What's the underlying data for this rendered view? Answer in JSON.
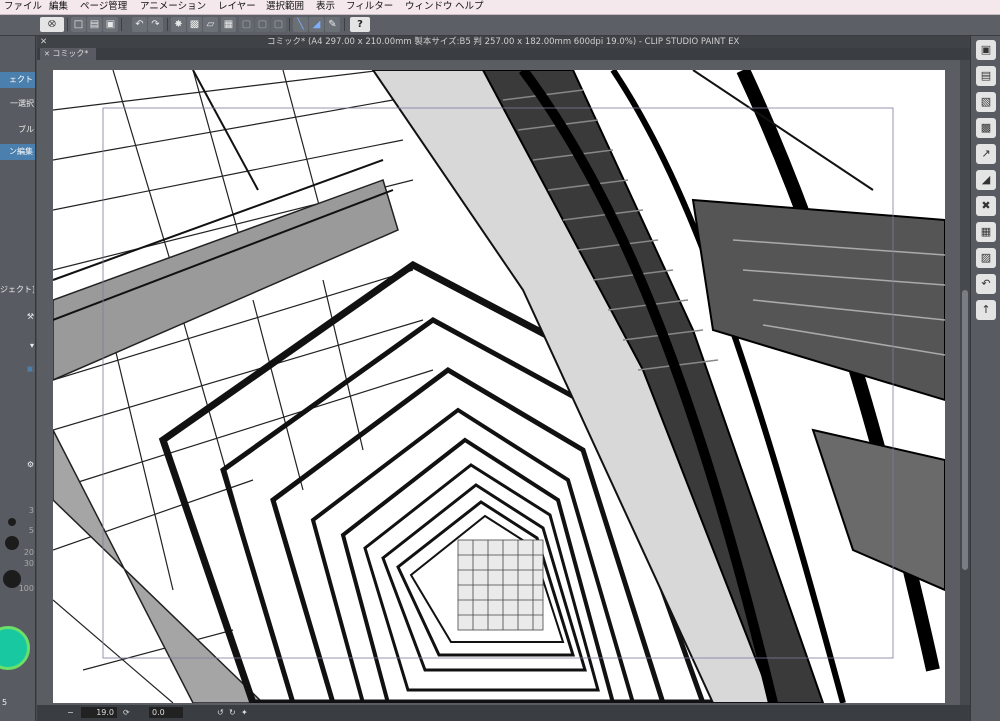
{
  "menu": [
    "ファイル",
    "編集",
    "ページ管理",
    "アニメーション",
    "レイヤー",
    "選択範囲",
    "表示",
    "フィルター",
    "ウィンドウ",
    "ヘルプ"
  ],
  "window_title": "コミック* (A4 297.00 x 210.00mm 製本サイズ:B5 判 257.00 x 182.00mm 600dpi 19.0%)  - CLIP STUDIO PAINT EX",
  "tab_label": "コミック*",
  "left_panel": {
    "items": [
      "ェクト",
      "一選択",
      "ブル",
      "ン編集",
      "ジェクト]"
    ],
    "brush_sizes": [
      "3",
      "5",
      "20",
      "30",
      "100"
    ],
    "bottom_label": "5"
  },
  "status": {
    "zoom": "19.0",
    "rotation": "0.0"
  },
  "toolbar_icons": [
    "clip-logo-icon",
    "new-file-icon",
    "open-file-icon",
    "save-icon",
    "undo-icon",
    "redo-icon",
    "transform-icon",
    "fill-icon",
    "eraser-icon",
    "grid-icon",
    "ruler-icon",
    "pen-icon",
    "help-icon"
  ],
  "colors": {
    "accent": "#4b7fad",
    "menubar": "#f4e8ec",
    "panel": "#585c62",
    "color_wheel": "#18c8a0"
  }
}
